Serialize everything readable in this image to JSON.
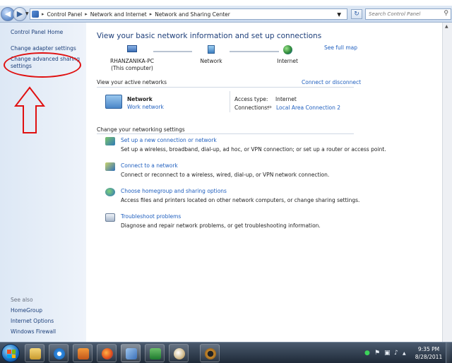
{
  "address_bar": {
    "breadcrumbs": [
      "Control Panel",
      "Network and Internet",
      "Network and Sharing Center"
    ],
    "search_placeholder": "Search Control Panel"
  },
  "left_nav": {
    "items": [
      "Control Panel Home",
      "Change adapter settings",
      "Change advanced sharing settings"
    ],
    "see_also_label": "See also",
    "see_also_items": [
      "HomeGroup",
      "Internet Options",
      "Windows Firewall"
    ]
  },
  "main": {
    "title": "View your basic network information and set up connections",
    "see_full_map": "See full map",
    "map_nodes": [
      {
        "label": "RHANZANIKA-PC",
        "sublabel": "(This computer)",
        "icon": "computer-icon"
      },
      {
        "label": "Network",
        "sublabel": "",
        "icon": "network-icon"
      },
      {
        "label": "Internet",
        "sublabel": "",
        "icon": "globe-icon"
      }
    ],
    "active_networks_heading": "View your active networks",
    "connect_or_disconnect": "Connect or disconnect",
    "active_network": {
      "name": "Network",
      "type": "Work network",
      "access_type_label": "Access type:",
      "access_type_value": "Internet",
      "connections_label": "Connections:",
      "connections_value": "Local Area Connection 2"
    },
    "change_settings_heading": "Change your networking settings",
    "tasks": [
      {
        "link": "Set up a new connection or network",
        "desc": "Set up a wireless, broadband, dial-up, ad hoc, or VPN connection; or set up a router or access point.",
        "icon": "new-connection-icon"
      },
      {
        "link": "Connect to a network",
        "desc": "Connect or reconnect to a wireless, wired, dial-up, or VPN network connection.",
        "icon": "connect-network-icon"
      },
      {
        "link": "Choose homegroup and sharing options",
        "desc": "Access files and printers located on other network computers, or change sharing settings.",
        "icon": "homegroup-icon"
      },
      {
        "link": "Troubleshoot problems",
        "desc": "Diagnose and repair network problems, or get troubleshooting information.",
        "icon": "troubleshoot-icon"
      }
    ]
  },
  "taskbar": {
    "apps": [
      "explorer-icon",
      "internet-explorer-icon",
      "media-player-icon",
      "firefox-icon",
      "control-panel-icon",
      "excel-icon",
      "paint-icon",
      "ring-app-icon"
    ],
    "time": "9:35 PM",
    "date": "8/28/2011"
  },
  "colors": {
    "link": "#1f5fbf",
    "annotation_red": "#e01010",
    "nav_bg": "#dde8f5",
    "taskbar": "#1f2a38"
  }
}
